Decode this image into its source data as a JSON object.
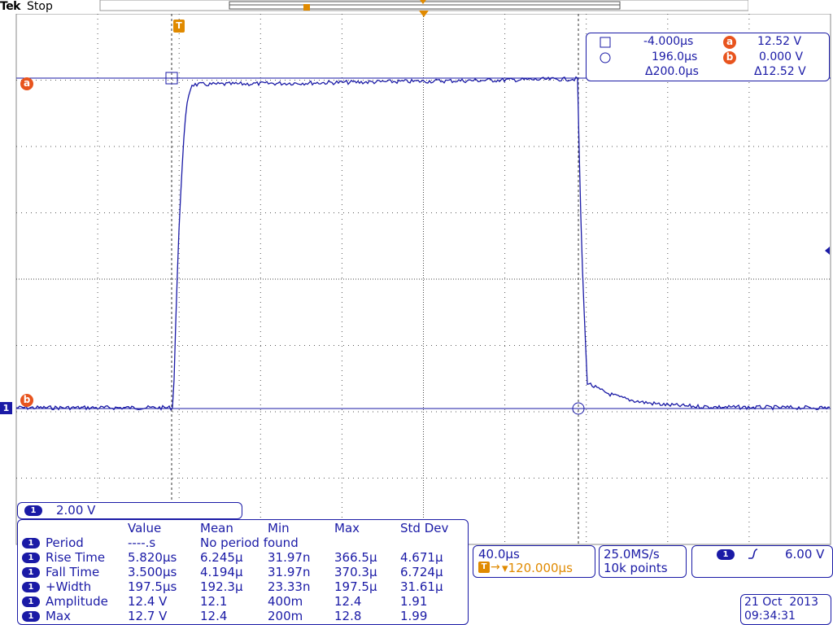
{
  "header": {
    "brand": "Tek",
    "state": "Stop"
  },
  "cursor_readout": {
    "row1": {
      "time": "-4.000µs",
      "channel": "a",
      "value": "12.52 V"
    },
    "row2": {
      "time": "196.0µs",
      "channel": "b",
      "value": "0.000 V"
    },
    "row3": {
      "delta_time": "Δ200.0µs",
      "delta_value": "Δ12.52 V"
    }
  },
  "markers": {
    "trigger_position": "T",
    "cursor_a": "a",
    "cursor_b": "b",
    "channel1": "1"
  },
  "channel_scale": {
    "channel": "1",
    "volts_per_div": "2.00 V"
  },
  "measurements": {
    "headers": [
      "Value",
      "Mean",
      "Min",
      "Max",
      "Std Dev"
    ],
    "rows": [
      {
        "channel": "1",
        "name": "Period",
        "value": "----.s",
        "mean": "No period found",
        "min": "",
        "max": "",
        "std": ""
      },
      {
        "channel": "1",
        "name": "Rise Time",
        "value": "5.820µs",
        "mean": "6.245µ",
        "min": "31.97n",
        "max": "366.5µ",
        "std": "4.671µ"
      },
      {
        "channel": "1",
        "name": "Fall Time",
        "value": "3.500µs",
        "mean": "4.194µ",
        "min": "31.97n",
        "max": "370.3µ",
        "std": "6.724µ"
      },
      {
        "channel": "1",
        "name": "+Width",
        "value": "197.5µs",
        "mean": "192.3µ",
        "min": "23.33n",
        "max": "197.5µ",
        "std": "31.61µ"
      },
      {
        "channel": "1",
        "name": "Amplitude",
        "value": "12.4 V",
        "mean": "12.1",
        "min": "400m",
        "max": "12.4",
        "std": "1.91"
      },
      {
        "channel": "1",
        "name": "Max",
        "value": "12.7 V",
        "mean": "12.4",
        "min": "200m",
        "max": "12.8",
        "std": "1.99"
      }
    ]
  },
  "timebase": {
    "time_per_div": "40.0µs",
    "trigger_delay": "▾120.000µs"
  },
  "acquisition": {
    "sample_rate": "25.0MS/s",
    "record_length": "10k points"
  },
  "trigger": {
    "channel": "1",
    "slope": "rising",
    "level": "6.00 V"
  },
  "datetime": {
    "date": "21 Oct  2013",
    "time": "09:34:31"
  },
  "colors": {
    "trace": "#1a1aa6",
    "accent": "#e8541e",
    "trigger": "#e08a00",
    "grid": "#555555"
  }
}
